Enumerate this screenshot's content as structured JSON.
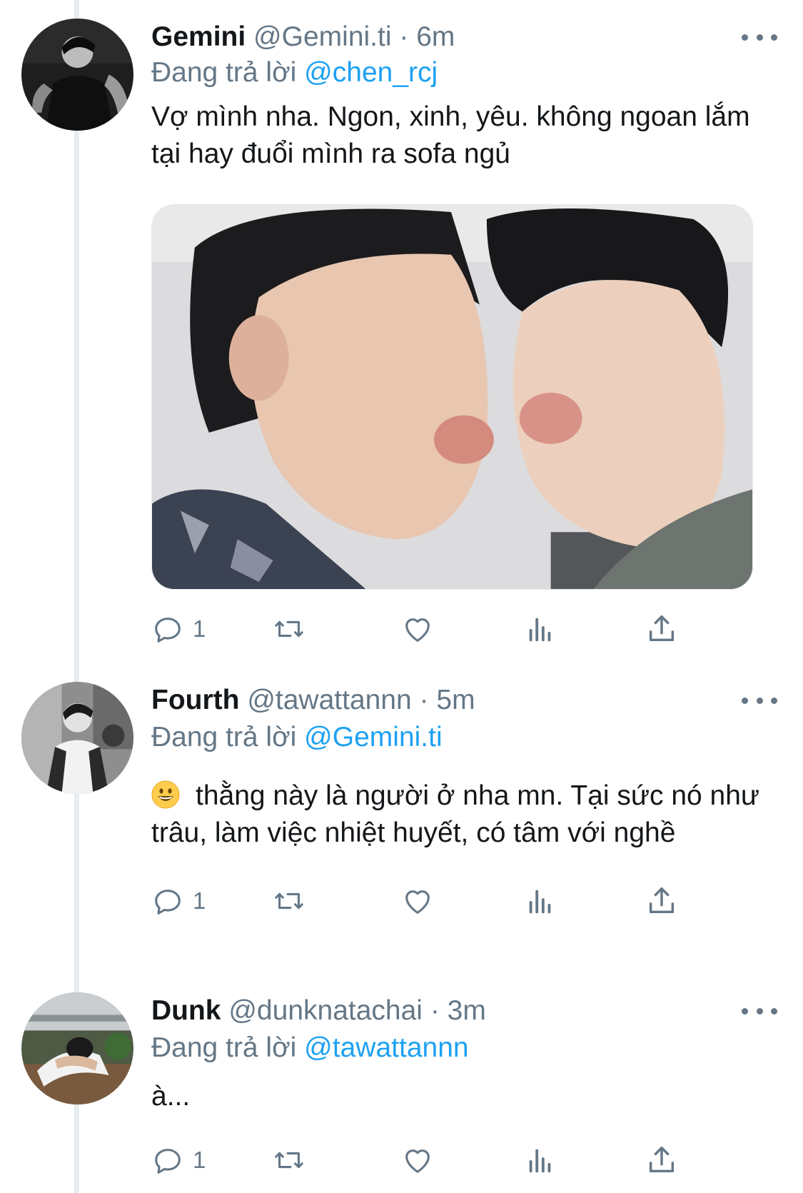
{
  "tweets": [
    {
      "name": "Gemini",
      "handle": "@Gemini.ti",
      "separator": "·",
      "time": "6m",
      "replying_prefix": "Đang trả lời",
      "replying_to": "@chen_rcj",
      "text": "Vợ mình nha. Ngon, xinh, yêu. không ngoan lắm tại hay đuổi mình ra sofa ngủ",
      "reply_count": "1"
    },
    {
      "name": "Fourth",
      "handle": "@tawattannn",
      "separator": "·",
      "time": "5m",
      "replying_prefix": "Đang trả lời",
      "replying_to": "@Gemini.ti",
      "text": "thằng này là người ở nha mn. Tại sức nó như trâu, làm việc nhiệt huyết, có tâm với nghề",
      "reply_count": "1"
    },
    {
      "name": "Dunk",
      "handle": "@dunknatachai",
      "separator": "·",
      "time": "3m",
      "replying_prefix": "Đang trả lời",
      "replying_to": "@tawattannn",
      "text": "à...",
      "reply_count": "1"
    }
  ],
  "colors": {
    "text": "#14171a",
    "secondary": "#657786",
    "link": "#1da1f2",
    "thread_line": "#e6ecf0"
  },
  "icons": [
    "reply-icon",
    "retweet-icon",
    "like-icon",
    "analytics-icon",
    "share-icon",
    "more-icon",
    "grinning-emoji"
  ]
}
